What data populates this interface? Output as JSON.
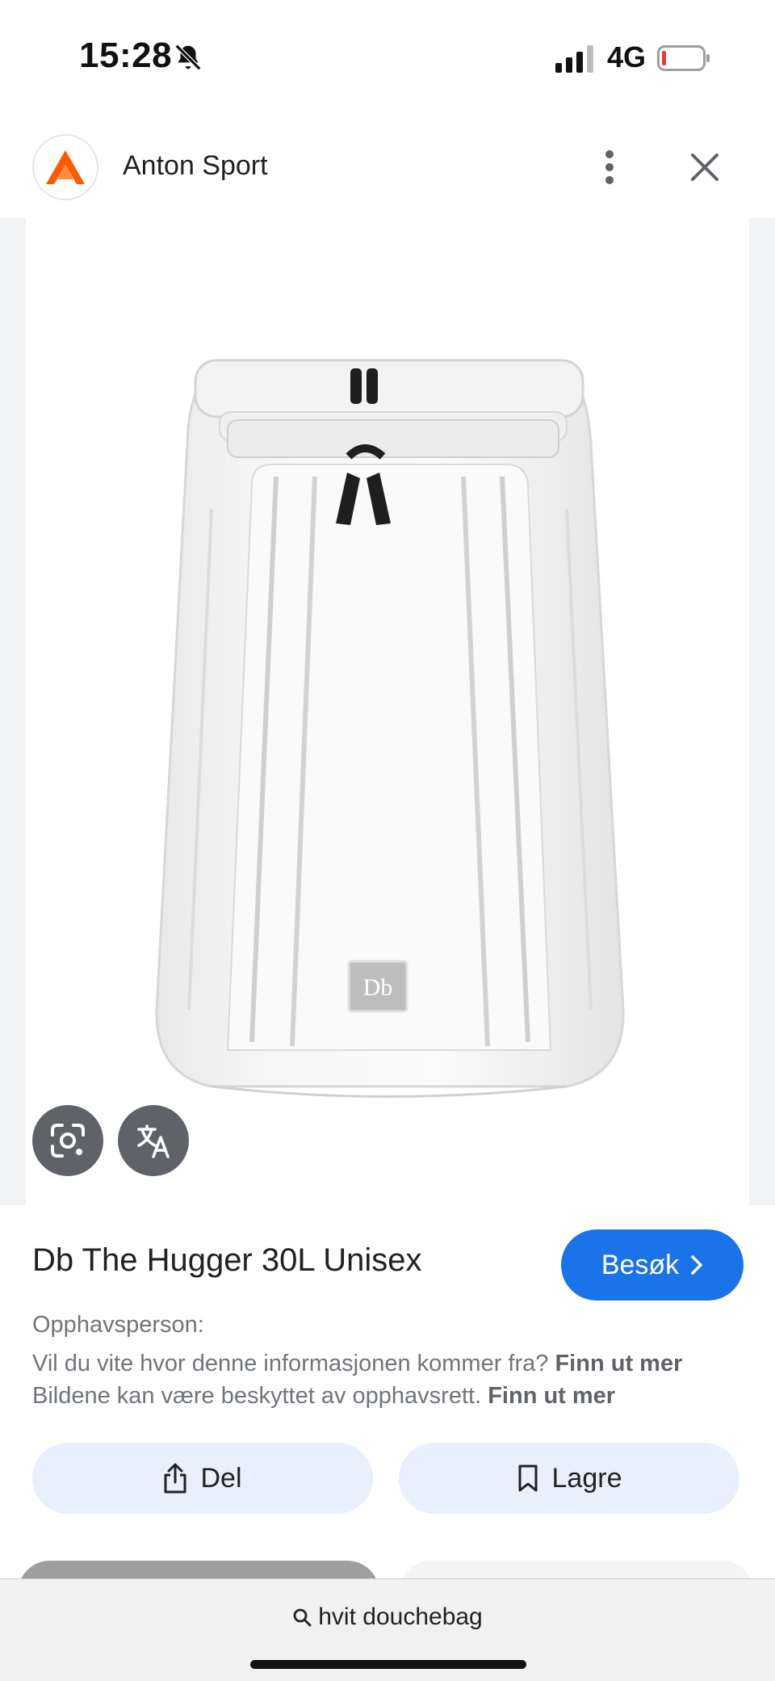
{
  "status_bar": {
    "time": "15:28",
    "network": "4G",
    "icons": [
      "bell-off-icon",
      "signal-icon",
      "battery-icon"
    ]
  },
  "header": {
    "source_name": "Anton Sport",
    "logo_icon": "anton-sport-logo",
    "brand_color": "#ff5a00"
  },
  "viewer": {
    "image_alt": "Db The Hugger 30L white backpack",
    "badge_text": "Db",
    "tools": [
      "google-lens-icon",
      "translate-icon"
    ]
  },
  "details": {
    "title": "Db The Hugger 30L Unisex",
    "visit_label": "Besøk",
    "credit_label": "Opphavsperson:",
    "info_text_1": "Vil du vite hvor denne informasjonen kommer fra?",
    "info_link_1": "Finn ut mer",
    "info_text_2": "Bildene kan være beskyttet av opphavsrett.",
    "info_link_2": "Finn ut mer",
    "share_label": "Del",
    "save_label": "Lagre",
    "accent": "#1a73e8",
    "pill_bg": "#e8f0fe"
  },
  "search": {
    "query": "hvit douchebag"
  }
}
